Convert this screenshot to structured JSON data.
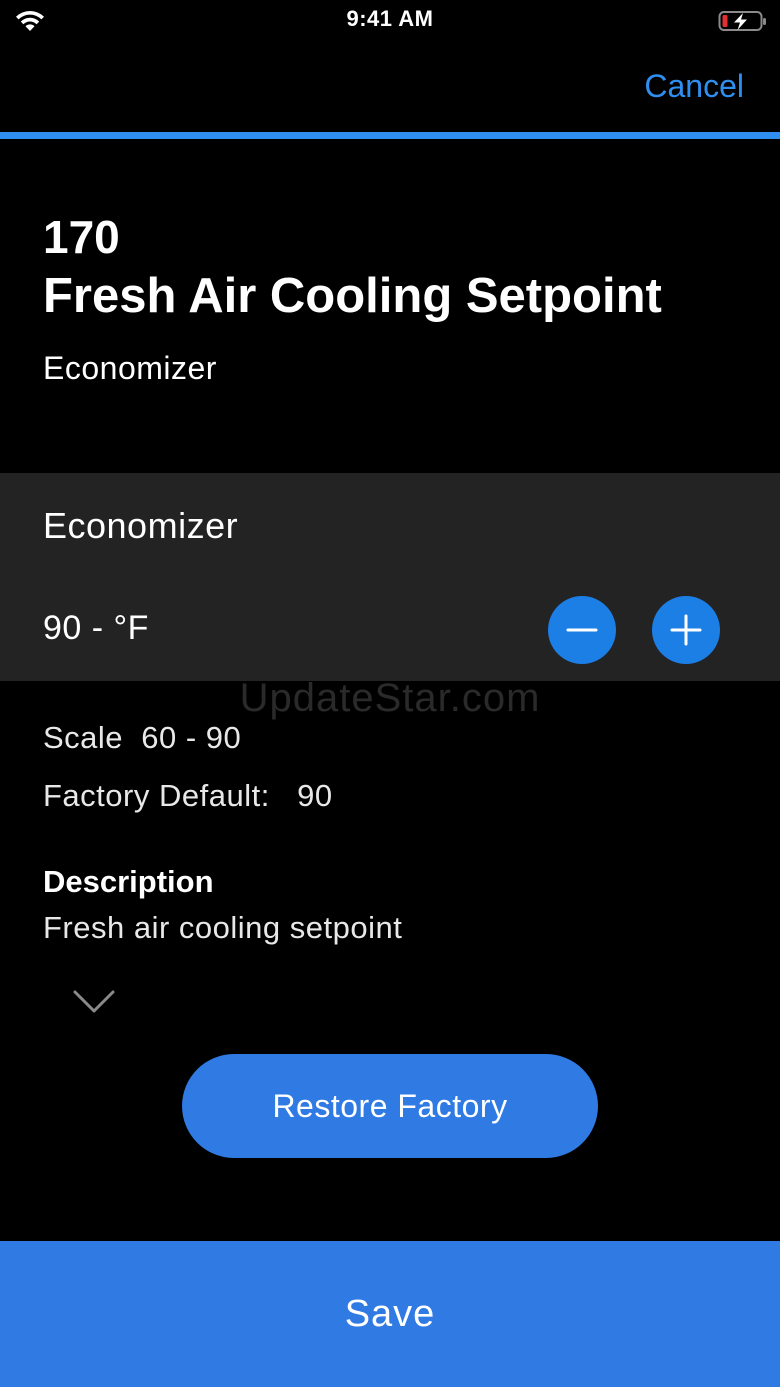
{
  "status_bar": {
    "time": "9:41 AM",
    "wifi_icon": "wifi-icon",
    "battery_icon": "battery-charging-low-icon"
  },
  "header": {
    "cancel_label": "Cancel"
  },
  "parameter": {
    "number": "170",
    "title": "Fresh Air Cooling Setpoint",
    "category": "Economizer"
  },
  "value_panel": {
    "label": "Economizer",
    "value": "90 - °F",
    "decrement_icon": "minus-icon",
    "increment_icon": "plus-icon"
  },
  "watermark": "UpdateStar.com",
  "details": {
    "scale_text": "Scale  60 - 90",
    "factory_default_text": "Factory Default:   90",
    "description_heading": "Description",
    "description_text": "Fresh air cooling setpoint",
    "expand_icon": "chevron-down-icon"
  },
  "actions": {
    "restore_label": "Restore Factory",
    "save_label": "Save"
  },
  "colors": {
    "accent": "#2f8ff0",
    "button": "#2f7ae3",
    "stepper": "#1b7fe6",
    "panel": "#232323",
    "background": "#000000",
    "battery_low": "#e03030"
  }
}
